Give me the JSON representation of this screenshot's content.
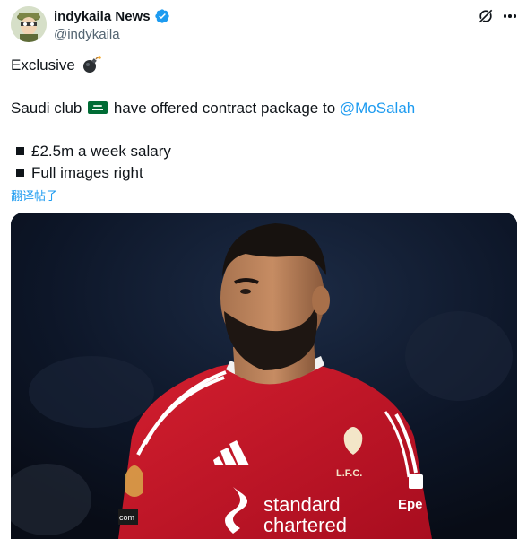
{
  "author": {
    "display_name": "indykaila News",
    "handle": "@indykaila",
    "verified": true,
    "avatar_icon": "cartoon-avatar-icon"
  },
  "actions": {
    "grok_icon": "grok-icon",
    "more_icon": "more-dots-icon"
  },
  "tweet": {
    "line1_text": "Exclusive",
    "line1_emoji": "bomb-emoji",
    "line2_before": "Saudi club",
    "line2_flag": "saudi-arabia-flag",
    "line2_middle": "have offered contract package to",
    "mention": "@MoSalah",
    "bullets": [
      "£2.5m a week salary",
      "Full images right"
    ],
    "translate_label": "翻译帖子"
  },
  "media": {
    "shirt_sponsor_line1": "standard",
    "shirt_sponsor_line2": "chartered",
    "crest_text": "L.F.C.",
    "sleeve_text": "Epe",
    "badge_text": "com"
  },
  "colors": {
    "accent": "#1d9bf0",
    "text": "#0f1419",
    "muted": "#536471",
    "shirt_red": "#c8102e"
  }
}
